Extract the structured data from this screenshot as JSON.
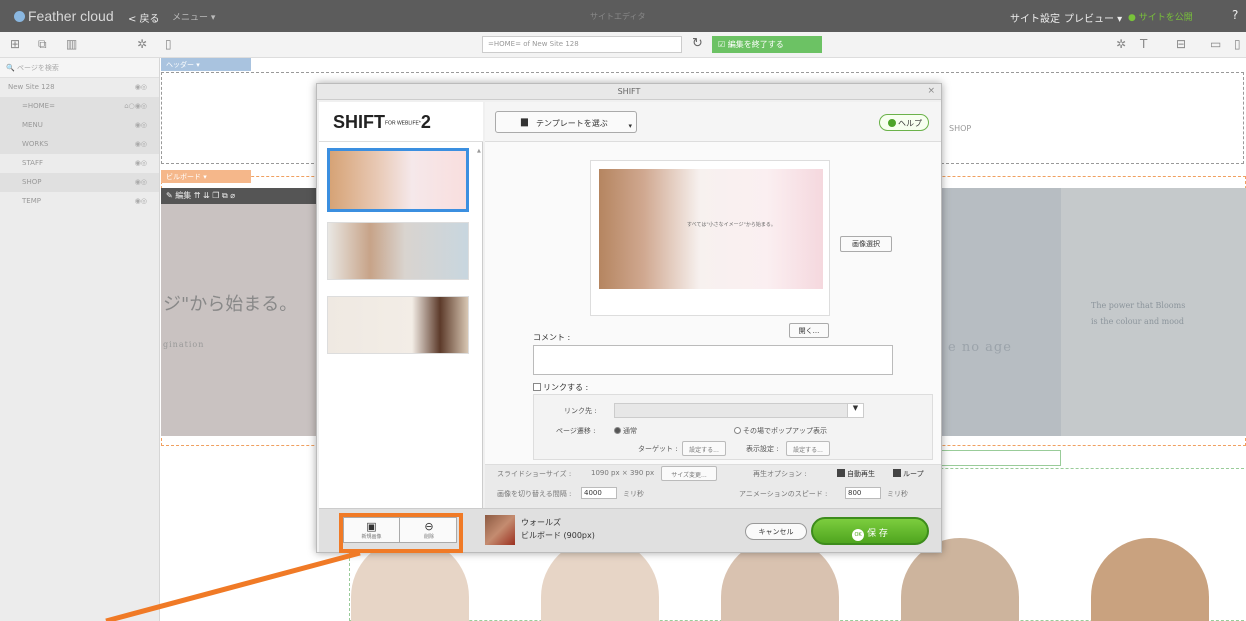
{
  "topbar": {
    "logo": "Feather cloud",
    "back": "< 戻る",
    "menu": "メニュー ▾",
    "center": "サイトエディタ",
    "site_settings": "サイト設定",
    "preview": "プレビュー ▾",
    "publish": "サイトを公開",
    "help": "?"
  },
  "toolbar": {
    "url": "=HOME= of New Site 128",
    "edit_end": "編集を終了する"
  },
  "sidebar": {
    "search_placeholder": "ページを検索",
    "pages": [
      {
        "label": "New Site 128"
      },
      {
        "label": "=HOME="
      },
      {
        "label": "MENU"
      },
      {
        "label": "WORKS"
      },
      {
        "label": "STAFF"
      },
      {
        "label": "SHOP"
      },
      {
        "label": "TEMP"
      }
    ]
  },
  "canvas": {
    "header_label": "ヘッダー",
    "shop": "SHOP",
    "billboard_label": "ビルボード",
    "edit_tools": "編集",
    "big_text": "ジ\"から始まる。",
    "img_text": "gination",
    "right_text": "e no age",
    "right_text2": "The power that Blooms\nis the colour and mood"
  },
  "modal": {
    "title": "SHIFT",
    "close": "×",
    "logo_main": "SHIFT",
    "logo_sub": "FOR WEBLIFE*",
    "logo_num": "2",
    "template_button": "テンプレートを選ぶ",
    "help_button": "ヘルプ",
    "image_select": "画像選択",
    "open_button": "開く...",
    "preview_text": "すべては\"小さなイメージ\"から始まる。",
    "comment_label": "コメント :",
    "link_label": "リンクする :",
    "link_target_label": "リンク先 :",
    "page_transition_label": "ページ遷移 :",
    "normal_option": "通常",
    "popup_option": "その場でポップアップ表示",
    "target_label": "ターゲット :",
    "target_btn": "設定する...",
    "display_label": "表示設定 :",
    "display_btn": "設定する...",
    "slideshow_size_label": "スライドショーサイズ :",
    "slideshow_size_value": "1090 px × 390 px",
    "size_change_btn": "サイズ変更...",
    "interval_label": "画像を切り替える間隔 :",
    "interval_value": "4000",
    "interval_unit": "ミリ秒",
    "playback_label": "再生オプション :",
    "autoplay": "自動再生",
    "loop": "ループ",
    "anim_speed_label": "アニメーションのスピード :",
    "anim_speed_value": "800",
    "anim_unit": "ミリ秒",
    "footer_btn1": "新規画像",
    "footer_btn2": "削除",
    "selected_name": "ウォールズ",
    "selected_sub": "ビルボード (900px)",
    "cancel": "キャンセル",
    "save": "保 存",
    "save_ok": "OK"
  },
  "colors": {
    "accent_green": "#4fa51f",
    "selection_blue": "#3b8fe0",
    "highlight_orange": "#f07a26"
  }
}
